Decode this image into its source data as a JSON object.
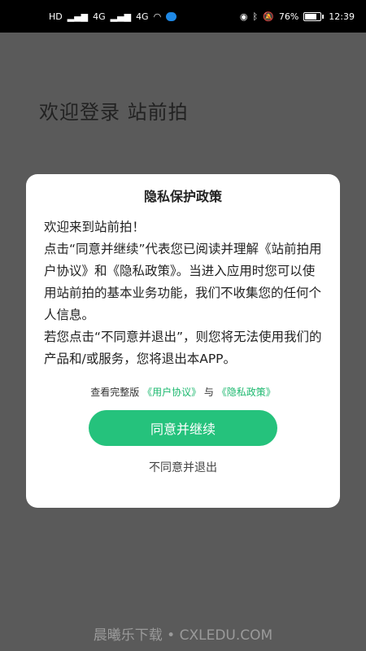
{
  "statusbar": {
    "network_labels": [
      "HD",
      "4G",
      "4G"
    ],
    "battery_percent": "76%",
    "battery_level": 0.76,
    "time": "12:39"
  },
  "welcome": {
    "title": "欢迎登录 站前拍"
  },
  "dialog": {
    "title": "隐私保护政策",
    "paragraphs": [
      "欢迎来到站前拍！",
      "点击“同意并继续”代表您已阅读并理解《站前拍用户协议》和《隐私政策》。当进入应用时您可以使用站前拍的基本业务功能，我们不收集您的任何个人信息。",
      "若您点击“不同意并退出”，则您将无法使用我们的产品和/或服务，您将退出本APP。"
    ],
    "agreement": {
      "prefix": "查看完整版",
      "user_agreement": "《用户协议》",
      "conjunction": "与",
      "privacy_policy": "《隐私政策》"
    },
    "agree_label": "同意并继续",
    "disagree_label": "不同意并退出"
  },
  "watermark": "晨曦乐下载 • CXLEDU.COM",
  "colors": {
    "accent": "#25c27c",
    "link": "#1bb86e",
    "overlay": "#5a5a5a"
  }
}
